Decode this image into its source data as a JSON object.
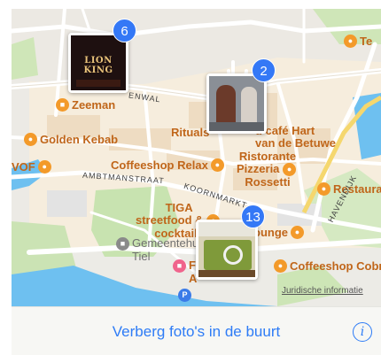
{
  "photo_clusters": [
    {
      "count": "6",
      "thumb_text": "LION KING"
    },
    {
      "count": "2"
    },
    {
      "count": "13"
    }
  ],
  "places": {
    "zeeman": "Zeeman",
    "golden_kebab": "Golden Kebab",
    "vof": "VOF",
    "rituals": "Rituals",
    "cafe_hart_1": "d café Hart",
    "cafe_hart_2": "van de Betuwe",
    "coffeeshop_relax": "Coffeeshop Relax",
    "pizzeria_1": "Ristorante",
    "pizzeria_2": "Pizzeria",
    "pizzeria_3": "Rossetti",
    "restaurant": "Restauran",
    "tiga_1": "TIGA",
    "tiga_2": "streetfood &",
    "tiga_3": "cocktails",
    "gemeente_1": "Gemeentehu",
    "gemeente_2": "Tiel",
    "lounge": "ounge",
    "fi_1": "Fi",
    "fi_2": "A",
    "coffeeshop_cobra": "Coffeeshop Cobra",
    "te": "Te"
  },
  "streets": {
    "nwal": "ENWAL",
    "ambtmanstraat": "AMBTMANSTRAAT",
    "koornmarkt": "KOORNMARKT",
    "havendijk": "HAVENDIJK"
  },
  "map_legal": "Juridische informatie",
  "bottom_bar": {
    "hide_photos_label": "Verberg foto's in de buurt",
    "info_label": "i"
  },
  "colors": {
    "accent": "#2e7cf6",
    "badge": "#3478f6",
    "water": "#6ec0f0",
    "park": "#c8e3b0",
    "poi": "#f39a2a"
  }
}
